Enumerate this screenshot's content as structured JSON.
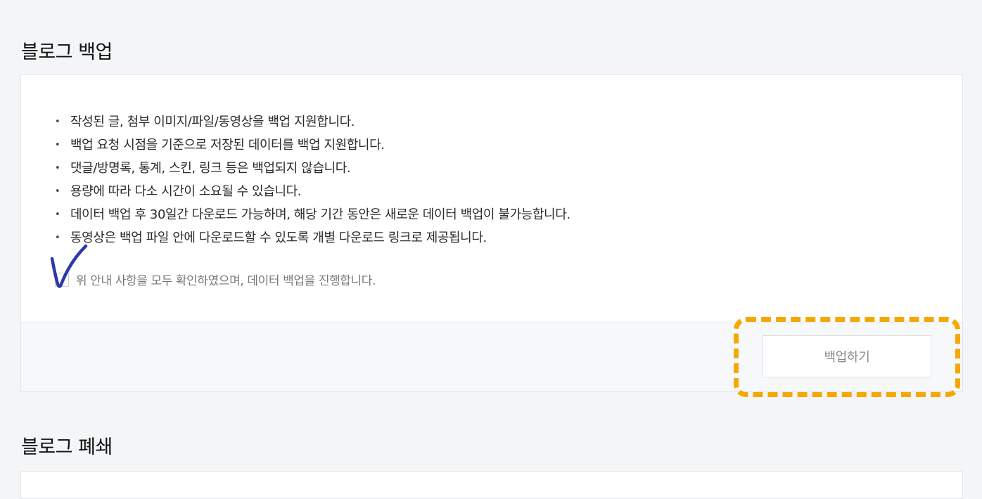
{
  "backup_section": {
    "title": "블로그 백업",
    "notices": [
      "작성된 글, 첨부 이미지/파일/동영상을 백업 지원합니다.",
      "백업 요청 시점을 기준으로 저장된 데이터를 백업 지원합니다.",
      "댓글/방명록, 통계, 스킨, 링크 등은 백업되지 않습니다.",
      "용량에 따라 다소 시간이 소요될 수 있습니다.",
      "데이터 백업 후 30일간 다운로드 가능하며, 해당 기간 동안은 새로운 데이터 백업이 불가능합니다.",
      "동영상은 백업 파일 안에 다운로드할 수 있도록 개별 다운로드 링크로 제공됩니다."
    ],
    "confirm_label": "위 안내 사항을 모두 확인하였으며, 데이터 백업을 진행합니다.",
    "confirm_checked": false,
    "backup_button_label": "백업하기"
  },
  "close_section": {
    "title": "블로그 폐쇄"
  },
  "annotations": {
    "checkmark_color": "#2b3aa8",
    "highlight_color": "#f5a800"
  }
}
